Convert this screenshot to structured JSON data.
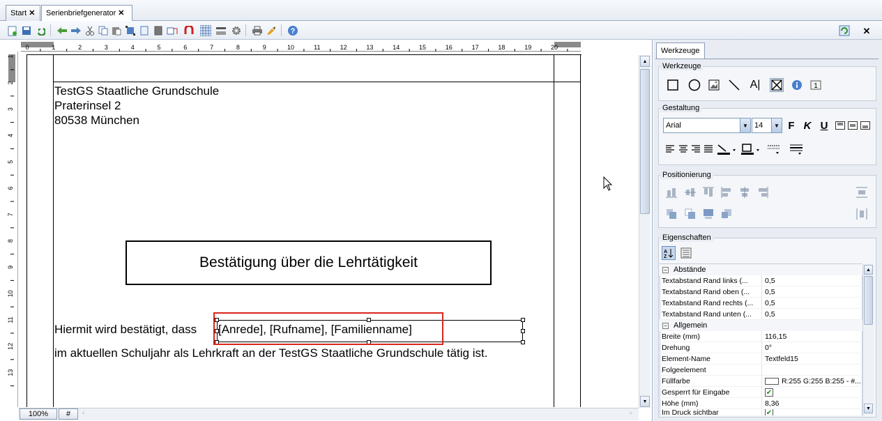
{
  "tabs": [
    {
      "label": "Start"
    },
    {
      "label": "Serienbriefgenerator"
    }
  ],
  "tab_close": "✕",
  "ruler": {
    "h_labels": [
      "1",
      "1",
      "2",
      "3",
      "4",
      "5",
      "6",
      "7",
      "8",
      "9",
      "10",
      "11",
      "12",
      "13",
      "14",
      "15",
      "16",
      "17",
      "18",
      "19",
      "20"
    ],
    "h_zero": "0",
    "v_labels": [
      "1",
      "2",
      "3",
      "4",
      "5",
      "6",
      "7",
      "8",
      "9",
      "10",
      "11",
      "12",
      "13"
    ]
  },
  "letter": {
    "line1": "TestGS Staatliche Grundschule",
    "line2": "Praterinsel 2",
    "line3": "80538 München",
    "heading": "Bestätigung über die Lehrtätigkeit",
    "body_start": "Hiermit wird bestätigt, dass",
    "fields": "[Anrede], [Rufname], [Familienname]",
    "body_line2": "im aktuellen Schuljahr als Lehrkraft an der TestGS Staatliche Grundschule tätig ist."
  },
  "statusbar": {
    "zoom": "100%",
    "hash": "#"
  },
  "panel": {
    "tab": "Werkzeuge",
    "groups": {
      "tools": "Werkzeuge",
      "style": "Gestaltung",
      "position": "Positionierung",
      "props": "Eigenschaften"
    },
    "font": "Arial",
    "size": "14",
    "bold": "F",
    "italic": "K",
    "underline": "U",
    "categories": {
      "spacing": "Abstände",
      "general": "Allgemein"
    },
    "props_spacing": [
      {
        "k": "Textabstand Rand links (...",
        "v": "0,5"
      },
      {
        "k": "Textabstand Rand oben (...",
        "v": "0,5"
      },
      {
        "k": "Textabstand Rand rechts (...",
        "v": "0,5"
      },
      {
        "k": "Textabstand Rand unten (...",
        "v": "0,5"
      }
    ],
    "props_general": [
      {
        "k": "Breite (mm)",
        "v": "116,15"
      },
      {
        "k": "Drehung",
        "v": "0°"
      },
      {
        "k": "Element-Name",
        "v": "Textfeld15"
      },
      {
        "k": "Folgeelement",
        "v": ""
      },
      {
        "k": "Füllfarbe",
        "v": "R:255 G:255 B:255 - #..."
      },
      {
        "k": "Gesperrt für Eingabe",
        "v": "✔"
      },
      {
        "k": "Höhe (mm)",
        "v": "8,36"
      },
      {
        "k": "Im Druck sichtbar",
        "v": "✔"
      }
    ]
  },
  "colors": {
    "accent": "#d9261c",
    "tab_border": "#8c9cb4",
    "panel_bg": "#e9edf3"
  }
}
